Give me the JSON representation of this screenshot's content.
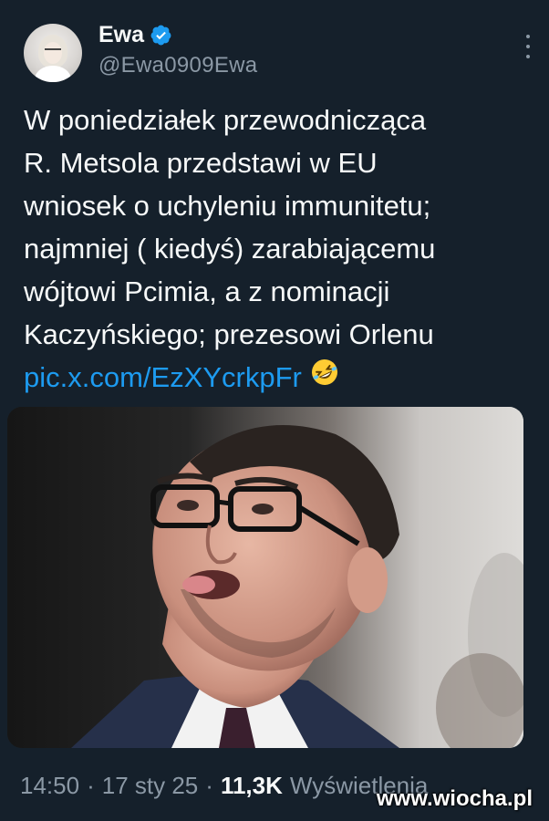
{
  "user": {
    "display_name": "Ewa",
    "handle": "@Ewa0909Ewa"
  },
  "tweet": {
    "lines": [
      "W poniedziałek przewodnicząca",
      "R. Metsola przedstawi w EU",
      "wniosek o uchyleniu immunitetu;",
      "najmniej ( kiedyś) zarabiającemu",
      "wójtowi Pcimia, a z nominacji",
      "Kaczyńskiego; prezesowi Orlenu"
    ],
    "link": "pic.x.com/EzXYcrkpFr",
    "emoji": "rolling-on-floor-laughing-emoji"
  },
  "meta": {
    "time": "14:50",
    "sep1": "·",
    "date": "17 sty 25",
    "sep2": "·",
    "views_count": "11,3K",
    "views_label": "Wyświetlenia"
  },
  "watermark": "www.wiocha.pl",
  "colors": {
    "background": "#15202b",
    "link": "#1d9bf0",
    "secondary_text": "#8b98a5",
    "verified": "#1d9bf0"
  }
}
